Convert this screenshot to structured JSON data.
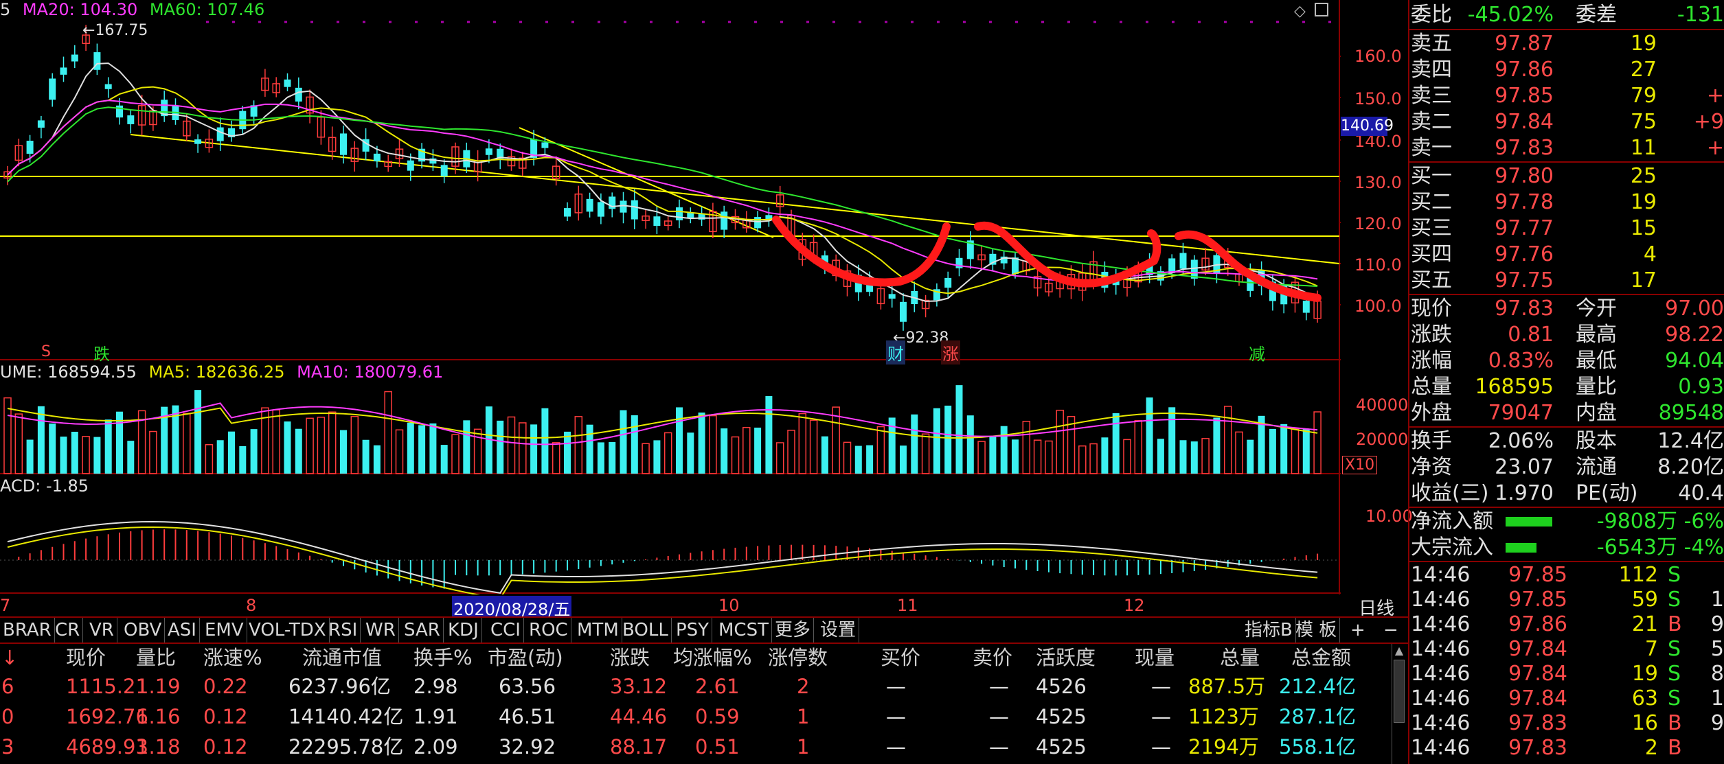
{
  "indicators": {
    "ma_row": [
      {
        "text": "5",
        "color": "#e0e0e0"
      },
      {
        "text": "MA20: 104.30",
        "color": "#ff3cff"
      },
      {
        "text": "MA60: 107.46",
        "color": "#2ee62e"
      }
    ],
    "vol_row": [
      {
        "text": "UME: 168594.55",
        "color": "#e0e0e0"
      },
      {
        "text": "MA5: 182636.25",
        "color": "#e8e800"
      },
      {
        "text": "MA10: 180079.61",
        "color": "#ff3cff"
      }
    ],
    "macd_label": "ACD: -1.85"
  },
  "price_axis": {
    "ticks": [
      "160.0",
      "150.0",
      "140.0",
      "130.0",
      "120.0",
      "110.0",
      "100.0"
    ],
    "current_label": "140.69",
    "vol_ticks": [
      "40000",
      "20000"
    ],
    "vol_unit": "X10",
    "macd_ticks": [
      "10.00"
    ]
  },
  "annotations": {
    "high_label": "167.75",
    "low_label": "92.38",
    "markers": [
      {
        "text": "S",
        "color": "#ff4a4a"
      },
      {
        "text": "跌",
        "color": "#2ee62e"
      },
      {
        "text": "财",
        "color": "#3cf0f0"
      },
      {
        "text": "涨",
        "color": "#ff4a4a"
      },
      {
        "text": "减",
        "color": "#2ee62e"
      }
    ]
  },
  "date_axis": {
    "labels": [
      "7",
      "8",
      "2020/08/28/五",
      "10",
      "11",
      "12"
    ],
    "right_label": "日线"
  },
  "tabs": [
    "BRAR",
    "CR",
    "VR",
    "OBV",
    "ASI",
    "EMV",
    "VOL-TDX",
    "RSI",
    "WR",
    "SAR",
    "KDJ",
    "CCI",
    "ROC",
    "MTM",
    "BOLL",
    "PSY",
    "MCST",
    "更多",
    "设置"
  ],
  "tabs_right": [
    "指标B",
    "模 板",
    "+",
    "−"
  ],
  "table": {
    "headers": [
      "现价",
      "量比",
      "涨速%",
      "流通市值",
      "换手%",
      "市盈(动)",
      "涨跌",
      "均涨幅%",
      "涨停数",
      "买价",
      "卖价",
      "活跃度",
      "现量",
      "总量",
      "总金额"
    ],
    "rows": [
      [
        "6",
        "1115.21",
        "1.19",
        "0.22",
        "6237.96亿",
        "2.98",
        "63.56",
        "33.12",
        "2.61",
        "2",
        "—",
        "—",
        "4526",
        "—",
        "887.5万",
        "212.4亿"
      ],
      [
        "0",
        "1692.76",
        "1.16",
        "0.12",
        "14140.42亿",
        "1.91",
        "46.51",
        "44.46",
        "0.59",
        "1",
        "—",
        "—",
        "4525",
        "—",
        "1123万",
        "287.1亿"
      ],
      [
        "3",
        "4689.93",
        "1.18",
        "0.12",
        "22295.78亿",
        "2.09",
        "32.92",
        "88.17",
        "0.51",
        "1",
        "—",
        "—",
        "4525",
        "—",
        "2194万",
        "558.1亿"
      ]
    ]
  },
  "order_book": {
    "weibi": {
      "label": "委比",
      "value": "-45.02%",
      "label2": "委差",
      "value2": "-131"
    },
    "asks": [
      {
        "label": "卖五",
        "price": "97.87",
        "vol": "19",
        "extra": ""
      },
      {
        "label": "卖四",
        "price": "97.86",
        "vol": "27",
        "extra": ""
      },
      {
        "label": "卖三",
        "price": "97.85",
        "vol": "79",
        "extra": "+"
      },
      {
        "label": "卖二",
        "price": "97.84",
        "vol": "75",
        "extra": "+9"
      },
      {
        "label": "卖一",
        "price": "97.83",
        "vol": "11",
        "extra": "+"
      }
    ],
    "bids": [
      {
        "label": "买一",
        "price": "97.80",
        "vol": "25"
      },
      {
        "label": "买二",
        "price": "97.78",
        "vol": "19"
      },
      {
        "label": "买三",
        "price": "97.77",
        "vol": "15"
      },
      {
        "label": "买四",
        "price": "97.76",
        "vol": "4"
      },
      {
        "label": "买五",
        "price": "97.75",
        "vol": "17"
      }
    ]
  },
  "quote": [
    {
      "l1": "现价",
      "v1": "97.83",
      "c1": "#ff4a4a",
      "l2": "今开",
      "v2": "97.00",
      "c2": "#ff4a4a"
    },
    {
      "l1": "涨跌",
      "v1": "0.81",
      "c1": "#ff4a4a",
      "l2": "最高",
      "v2": "98.22",
      "c2": "#ff4a4a"
    },
    {
      "l1": "涨幅",
      "v1": "0.83%",
      "c1": "#ff4a4a",
      "l2": "最低",
      "v2": "94.04",
      "c2": "#2ee62e"
    },
    {
      "l1": "总量",
      "v1": "168595",
      "c1": "#e8e800",
      "l2": "量比",
      "v2": "0.93",
      "c2": "#2ee62e"
    },
    {
      "l1": "外盘",
      "v1": "79047",
      "c1": "#ff4a4a",
      "l2": "内盘",
      "v2": "89548",
      "c2": "#2ee62e"
    }
  ],
  "stats": [
    {
      "l1": "换手",
      "v1": "2.06%",
      "l2": "股本",
      "v2": "12.4亿"
    },
    {
      "l1": "净资",
      "v1": "23.07",
      "l2": "流通",
      "v2": "8.20亿"
    },
    {
      "l1": "收益(三)",
      "v1": "1.970",
      "l2": "PE(动)",
      "v2": "40.4"
    }
  ],
  "flows": [
    {
      "label": "净流入额",
      "value": "-9808万",
      "pct": "-6%",
      "bar": 0.62
    },
    {
      "label": "大宗流入",
      "value": "-6543万",
      "pct": "-4%",
      "bar": 0.41
    }
  ],
  "ticks": [
    {
      "time": "14:46",
      "price": "97.85",
      "vol": "112",
      "side": "S",
      "extra": ""
    },
    {
      "time": "14:46",
      "price": "97.85",
      "vol": "59",
      "side": "S",
      "extra": "1"
    },
    {
      "time": "14:46",
      "price": "97.86",
      "vol": "21",
      "side": "B",
      "extra": "9"
    },
    {
      "time": "14:46",
      "price": "97.84",
      "vol": "7",
      "side": "S",
      "extra": "5"
    },
    {
      "time": "14:46",
      "price": "97.84",
      "vol": "19",
      "side": "S",
      "extra": "8"
    },
    {
      "time": "14:46",
      "price": "97.84",
      "vol": "63",
      "side": "S",
      "extra": "1"
    },
    {
      "time": "14:46",
      "price": "97.83",
      "vol": "16",
      "side": "B",
      "extra": "9"
    },
    {
      "time": "14:46",
      "price": "97.83",
      "vol": "2",
      "side": "B",
      "extra": ""
    }
  ],
  "colors": {
    "up": "#ff3c3c",
    "down": "#3cf0f0",
    "grid": "#8a0000",
    "ma5": "#e0e0e0",
    "ma10": "#e8e800",
    "ma20": "#ff3cff",
    "ma60": "#2ee62e",
    "hline": "#ffff00",
    "handdraw": "#ff1a1a"
  }
}
